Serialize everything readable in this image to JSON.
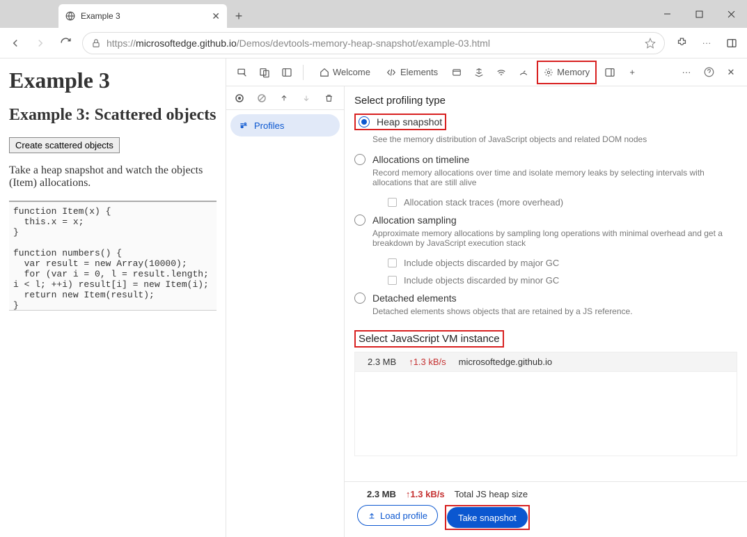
{
  "browser": {
    "tab_title": "Example 3",
    "url_prefix": "https://",
    "url_host": "microsoftedge.github.io",
    "url_path": "/Demos/devtools-memory-heap-snapshot/example-03.html"
  },
  "page": {
    "h1": "Example 3",
    "h2": "Example 3: Scattered objects",
    "button_label": "Create scattered objects",
    "paragraph": "Take a heap snapshot and watch the objects (Item) allocations.",
    "code": "function Item(x) {\n  this.x = x;\n}\n\nfunction numbers() {\n  var result = new Array(10000);\n  for (var i = 0, l = result.length;\ni < l; ++i) result[i] = new Item(i);\n  return new Item(result);\n}"
  },
  "devtools": {
    "tabs": {
      "welcome": "Welcome",
      "elements": "Elements",
      "memory": "Memory"
    },
    "sidebar": {
      "profiles": "Profiles"
    }
  },
  "memory": {
    "heading_type": "Select profiling type",
    "options": {
      "heap": {
        "label": "Heap snapshot",
        "desc": "See the memory distribution of JavaScript objects and related DOM nodes"
      },
      "timeline": {
        "label": "Allocations on timeline",
        "desc": "Record memory allocations over time and isolate memory leaks by selecting intervals with allocations that are still alive",
        "chk1": "Allocation stack traces (more overhead)"
      },
      "sampling": {
        "label": "Allocation sampling",
        "desc": "Approximate memory allocations by sampling long operations with minimal overhead and get a breakdown by JavaScript execution stack",
        "chk_major": "Include objects discarded by major GC",
        "chk_minor": "Include objects discarded by minor GC"
      },
      "detached": {
        "label": "Detached elements",
        "desc": "Detached elements shows objects that are retained by a JS reference."
      }
    },
    "heading_vm": "Select JavaScript VM instance",
    "vm_row": {
      "size": "2.3 MB",
      "rate": "↑1.3 kB/s",
      "host": "microsoftedge.github.io"
    },
    "footer": {
      "size": "2.3 MB",
      "rate": "↑1.3 kB/s",
      "label": "Total JS heap size",
      "load": "Load profile",
      "take": "Take snapshot"
    }
  }
}
